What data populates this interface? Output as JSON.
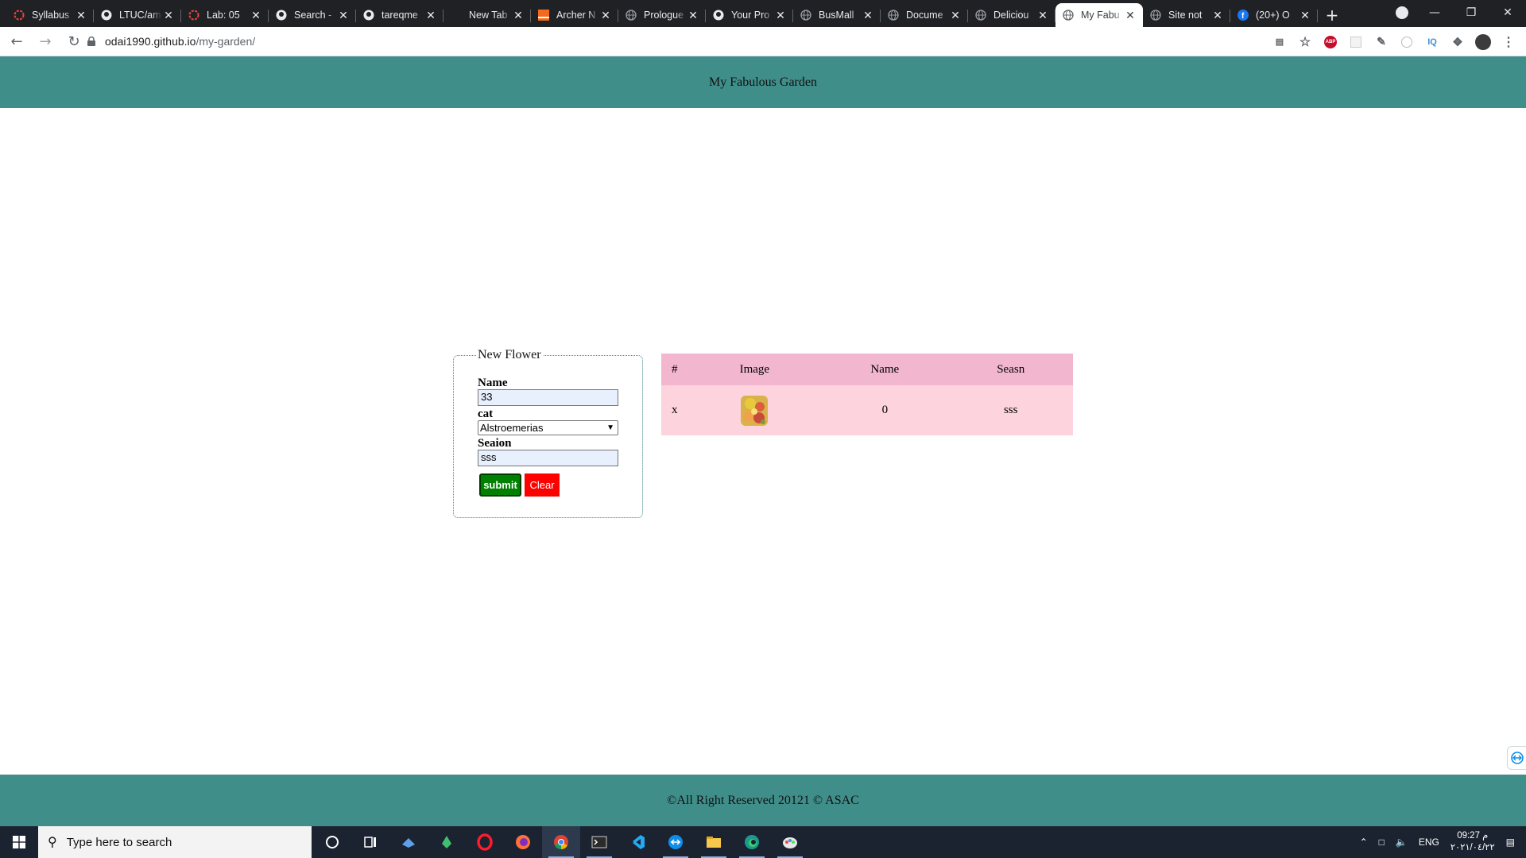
{
  "browser": {
    "tabs": [
      {
        "title": "Syllabus",
        "icon": "red-ring-icon",
        "active": false
      },
      {
        "title": "LTUC/am",
        "icon": "github-icon",
        "active": false
      },
      {
        "title": "Lab: 05",
        "icon": "red-ring-icon",
        "active": false
      },
      {
        "title": "Search -",
        "icon": "github-icon",
        "active": false
      },
      {
        "title": "tareqme",
        "icon": "github-icon",
        "active": false
      },
      {
        "title": "New Tab",
        "icon": "none",
        "active": false
      },
      {
        "title": "Archer N",
        "icon": "orange-square-icon",
        "active": false
      },
      {
        "title": "Prologue",
        "icon": "globe-icon",
        "active": false
      },
      {
        "title": "Your Pro",
        "icon": "github-icon",
        "active": false
      },
      {
        "title": "BusMall",
        "icon": "globe-icon",
        "active": false
      },
      {
        "title": "Docume",
        "icon": "globe-icon",
        "active": false
      },
      {
        "title": "Deliciou",
        "icon": "globe-icon",
        "active": false
      },
      {
        "title": "My Fabu",
        "icon": "globe-icon",
        "active": true
      },
      {
        "title": "Site not",
        "icon": "globe-icon",
        "active": false
      },
      {
        "title": "(20+) O",
        "icon": "facebook-icon",
        "active": false
      }
    ],
    "new_tab_label": "+",
    "url_host": "odai1990.github.io",
    "url_path": "/my-garden/",
    "extensions": [
      "translate-icon",
      "star-icon",
      "abp-icon",
      "blank-ext-icon",
      "eyedropper-icon",
      "circle-ext-icon",
      "iq-icon",
      "puzzle-icon",
      "profile-avatar-icon",
      "kebab-menu-icon"
    ],
    "abp_label": "ABP",
    "iq_label": "IQ"
  },
  "page": {
    "header_title": "My Fabulous Garden",
    "form": {
      "legend": "New Flower",
      "name_label": "Name",
      "name_value": "33",
      "cat_label": "cat",
      "cat_selected": "Alstroemerias",
      "season_label": "Seaion",
      "season_value": "sss",
      "submit_label": "submit",
      "clear_label": "Clear"
    },
    "table": {
      "headers": [
        "#",
        "Image",
        "Name",
        "Seasn"
      ],
      "rows": [
        {
          "delete": "x",
          "image": "flower-thumbnail",
          "name": "0",
          "season": "sss"
        }
      ]
    },
    "footer_text": "©All Right Reserved 20121 © ASAC"
  },
  "taskbar": {
    "search_placeholder": "Type here to search",
    "apps": [
      "cortana-icon",
      "task-view-icon",
      "app-blue-icon",
      "app-green-icon",
      "opera-icon",
      "firefox-icon",
      "chrome-icon",
      "terminal-icon",
      "vscode-icon",
      "teamviewer-icon",
      "file-explorer-icon",
      "edge-icon",
      "paint-icon"
    ],
    "tray": {
      "lang": "ENG",
      "time": "09:27 م",
      "date": "٢٠٢١/٠٤/٢٢"
    }
  },
  "colors": {
    "teal": "#408e8a",
    "table_header": "#f2b6cf",
    "table_row": "#fdd3de",
    "submit": "#008000",
    "clear": "#ff0000"
  }
}
